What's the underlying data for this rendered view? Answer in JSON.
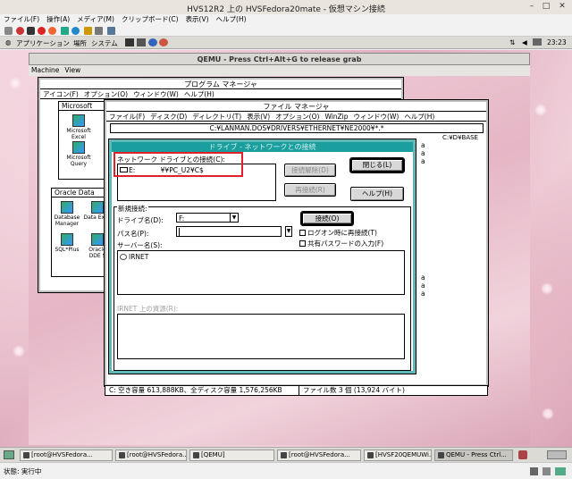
{
  "host": {
    "title": "HVS12R2 上の HVSFedora20mate - 仮想マシン接続",
    "menu": [
      "ファイル(F)",
      "操作(A)",
      "メディア(M)",
      "クリップボード(C)",
      "表示(V)",
      "ヘルプ(H)"
    ],
    "status_text": "状態: 実行中"
  },
  "guest_panel": {
    "menu": [
      "アプリケーション",
      "場所",
      "システム"
    ],
    "clock": "23:23"
  },
  "qemu": {
    "title": "QEMU - Press Ctrl+Alt+G to release grab",
    "menu": [
      "Machine",
      "View"
    ]
  },
  "progman": {
    "title": "プログラム マネージャ",
    "menu": [
      "アイコン(F)",
      "オプション(O)",
      "ウィンドウ(W)",
      "ヘルプ(H)"
    ],
    "group1": {
      "title": "Microsoft",
      "items": [
        "Microsoft Excel",
        "Microsoft Query"
      ]
    },
    "group2": {
      "title": "Oracle Data",
      "items": [
        "Database Manager",
        "Data Expo",
        "SQL*Plus",
        "Oracle DDE S"
      ]
    }
  },
  "fileman": {
    "title": "ファイル マネージャ",
    "menu": [
      "ファイル(F)",
      "ディスク(D)",
      "ディレクトリ(T)",
      "表示(V)",
      "オプション(O)",
      "WinZip",
      "ウィンドウ(W)",
      "ヘルプ(H)"
    ],
    "path": "C:¥LANMAN.DOS¥DRIVERS¥ETHERNET¥NE2000¥*.*",
    "path2": "C:¥D¥BASE",
    "status_left": "C: 空き容量 613,888KB、全ディスク容量 1,576,256KB",
    "status_right": "ファイル数 3 個 (13,924 バイト)",
    "side_letters": [
      "a",
      "a",
      "a",
      "a",
      "a",
      "a"
    ]
  },
  "dialog": {
    "title": "ドライブ - ネットワークとの接続",
    "connected_label": "ネットワーク ドライブとの接続(C):",
    "connected_entry_drive": "E:",
    "connected_entry_path": "¥¥PC_U2¥C$",
    "disconnect_button": "接続解除(D)",
    "reconnect_button": "再接続(R)",
    "close_button": "閉じる(L)",
    "help_button": "ヘルプ(H)",
    "new_connection_label": "新規接続:",
    "drive_label": "ドライブ名(D):",
    "drive_value": "F:",
    "path_label": "パス名(P):",
    "path_value": "",
    "connect_button": "接続(O)",
    "logon_reconnect_label": "ログオン時に再接続(T)",
    "shared_password_label": "共有パスワードの入力(F)",
    "server_label": "サーバー名(S):",
    "server_item": "IRNET",
    "resources_label": "IRNET 上の資源(R):"
  },
  "taskbar": {
    "items": [
      "[root@HVSFedora...",
      "[root@HVSFedora...",
      "[QEMU]",
      "[root@HVSFedora...",
      "[HVSF20QEMUWi...",
      "QEMU - Press Ctrl..."
    ]
  },
  "colors": {
    "dialog_caption": "#1b9e9e",
    "highlight_frame": "#e0212b"
  }
}
